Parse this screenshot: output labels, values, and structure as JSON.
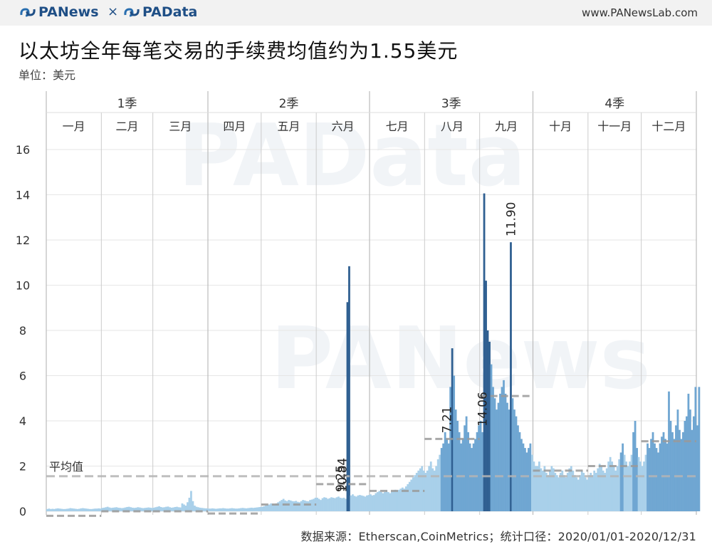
{
  "header": {
    "brand_left": "PANews",
    "separator": "×",
    "brand_right": "PAData",
    "url": "www.PANewsLab.com"
  },
  "title": "以太坊全年每笔交易的手续费均值约为1.55美元",
  "unit": "单位：美元",
  "source": "数据来源：Etherscan,CoinMetrics；统计口径：2020/01/01-2020/12/31",
  "watermarks": [
    "PAData",
    "PANews"
  ],
  "colors": {
    "bar_light": "#a9d0ea",
    "bar_mid": "#6fa6d2",
    "bar_dark": "#2f5f91",
    "grid": "#e6e6e6",
    "month_line": "#cccccc",
    "avg_line": "#b5b5b5",
    "text": "#333333"
  },
  "chart_data": {
    "type": "bar",
    "title": "以太坊全年每笔交易的手续费均值约为1.55美元",
    "ylabel": "单位：美元",
    "ylim": [
      -0.3,
      17
    ],
    "yticks": [
      0,
      2,
      4,
      6,
      8,
      10,
      12,
      14,
      16
    ],
    "quarters": [
      "1季",
      "2季",
      "3季",
      "4季"
    ],
    "months": [
      "一月",
      "二月",
      "三月",
      "四月",
      "五月",
      "六月",
      "七月",
      "八月",
      "九月",
      "十月",
      "十一月",
      "十二月"
    ],
    "average": {
      "label": "平均值",
      "value": 1.55
    },
    "monthly_means": [
      -0.2,
      0.0,
      0.0,
      -0.1,
      0.3,
      1.2,
      0.9,
      3.2,
      5.1,
      1.8,
      2.0,
      3.1
    ],
    "annotations": [
      {
        "day": 165,
        "label": "9.25"
      },
      {
        "day": 166,
        "label": "10.84"
      },
      {
        "day": 225,
        "label": "7.21"
      },
      {
        "day": 245,
        "label": "14.06"
      },
      {
        "day": 261,
        "label": "11.90"
      }
    ],
    "daily_values": [
      0.1,
      0.12,
      0.1,
      0.11,
      0.1,
      0.12,
      0.13,
      0.12,
      0.11,
      0.1,
      0.1,
      0.11,
      0.12,
      0.14,
      0.13,
      0.12,
      0.11,
      0.1,
      0.11,
      0.13,
      0.14,
      0.13,
      0.12,
      0.11,
      0.1,
      0.1,
      0.11,
      0.12,
      0.12,
      0.13,
      0.12,
      0.15,
      0.16,
      0.18,
      0.2,
      0.17,
      0.15,
      0.16,
      0.17,
      0.18,
      0.16,
      0.15,
      0.14,
      0.15,
      0.17,
      0.19,
      0.2,
      0.18,
      0.16,
      0.15,
      0.16,
      0.18,
      0.17,
      0.15,
      0.14,
      0.15,
      0.16,
      0.17,
      0.16,
      0.15,
      0.16,
      0.18,
      0.2,
      0.22,
      0.19,
      0.17,
      0.18,
      0.2,
      0.21,
      0.18,
      0.16,
      0.17,
      0.19,
      0.2,
      0.18,
      0.17,
      0.35,
      0.3,
      0.25,
      0.4,
      0.6,
      0.9,
      0.45,
      0.25,
      0.2,
      0.18,
      0.16,
      0.15,
      0.14,
      0.13,
      0.13,
      0.12,
      0.12,
      0.13,
      0.12,
      0.11,
      0.12,
      0.13,
      0.13,
      0.14,
      0.13,
      0.12,
      0.12,
      0.13,
      0.14,
      0.13,
      0.12,
      0.12,
      0.13,
      0.14,
      0.15,
      0.14,
      0.13,
      0.14,
      0.15,
      0.16,
      0.15,
      0.16,
      0.17,
      0.18,
      0.19,
      0.2,
      0.22,
      0.25,
      0.28,
      0.3,
      0.35,
      0.32,
      0.3,
      0.35,
      0.4,
      0.45,
      0.5,
      0.55,
      0.48,
      0.45,
      0.5,
      0.48,
      0.45,
      0.44,
      0.46,
      0.42,
      0.4,
      0.45,
      0.5,
      0.48,
      0.45,
      0.44,
      0.5,
      0.52,
      0.55,
      0.6,
      0.6,
      0.55,
      0.5,
      0.58,
      0.62,
      0.6,
      0.55,
      0.58,
      0.62,
      0.6,
      0.58,
      0.62,
      0.65,
      0.6,
      0.58,
      0.6,
      0.55,
      9.25,
      10.84,
      0.7,
      0.75,
      0.68,
      0.65,
      0.7,
      0.72,
      0.7,
      0.68,
      0.65,
      0.7,
      0.72,
      0.75,
      0.7,
      0.72,
      0.8,
      0.85,
      0.9,
      0.85,
      0.8,
      0.85,
      0.9,
      0.85,
      0.8,
      0.88,
      0.9,
      0.95,
      0.92,
      0.95,
      1.0,
      1.05,
      1.0,
      1.1,
      1.2,
      1.3,
      1.4,
      1.5,
      1.6,
      1.7,
      1.8,
      1.9,
      2.0,
      1.8,
      1.7,
      1.8,
      2.0,
      2.2,
      1.9,
      1.8,
      2.0,
      2.3,
      2.5,
      2.8,
      3.0,
      3.5,
      3.2,
      3.0,
      5.5,
      7.21,
      6.0,
      4.5,
      4.0,
      3.5,
      3.0,
      3.2,
      3.8,
      4.2,
      3.5,
      3.0,
      2.8,
      3.0,
      3.2,
      3.5,
      3.8,
      4.0,
      3.5,
      14.06,
      10.2,
      8.0,
      7.5,
      6.5,
      5.5,
      5.0,
      4.5,
      4.8,
      5.2,
      5.5,
      5.8,
      5.2,
      4.8,
      4.5,
      11.9,
      5.0,
      4.5,
      4.2,
      3.8,
      3.5,
      3.2,
      3.0,
      2.8,
      2.6,
      2.8,
      3.0,
      2.5,
      2.2,
      2.0,
      2.0,
      2.2,
      1.9,
      1.8,
      2.0,
      1.7,
      1.6,
      1.8,
      2.0,
      1.9,
      1.7,
      1.6,
      1.5,
      1.7,
      1.8,
      1.6,
      1.5,
      1.7,
      1.9,
      2.0,
      1.8,
      1.6,
      1.5,
      1.4,
      1.6,
      1.8,
      1.7,
      1.5,
      1.4,
      1.6,
      1.7,
      1.6,
      1.8,
      1.7,
      1.9,
      2.1,
      2.0,
      1.8,
      1.7,
      1.9,
      2.2,
      2.4,
      2.2,
      2.0,
      1.8,
      2.0,
      2.3,
      2.6,
      3.0,
      2.5,
      2.2,
      2.0,
      2.2,
      2.5,
      3.5,
      4.0,
      2.8,
      2.4,
      2.2,
      2.0,
      2.2,
      2.5,
      3.0,
      2.8,
      3.2,
      3.5,
      3.0,
      2.8,
      2.6,
      3.0,
      3.3,
      3.5,
      3.2,
      3.0,
      5.3,
      4.0,
      3.5,
      3.2,
      3.8,
      4.5,
      3.6,
      3.2,
      3.5,
      4.0,
      4.2,
      5.2,
      4.5,
      3.6,
      4.2,
      5.5,
      3.8,
      5.5
    ]
  }
}
